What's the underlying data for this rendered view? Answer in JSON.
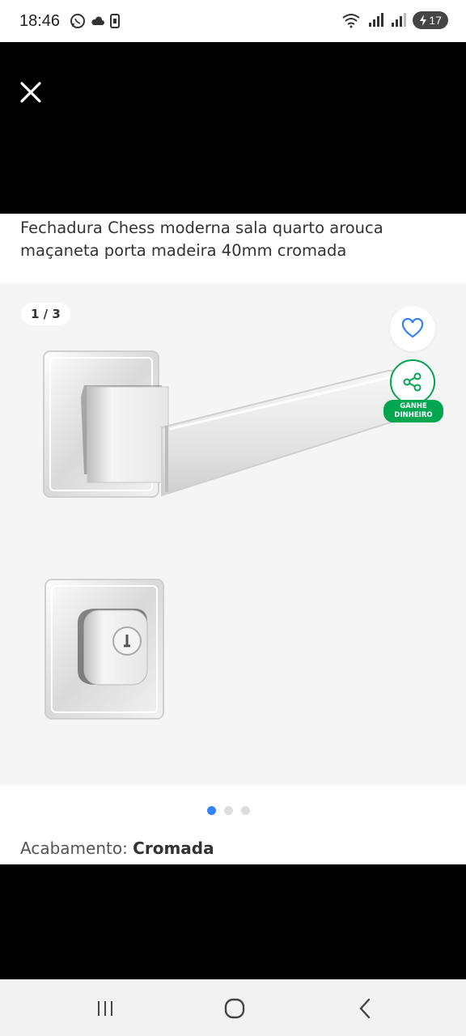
{
  "status_bar": {
    "time": "18:46",
    "battery": "17"
  },
  "product": {
    "title": "Fechadura Chess moderna sala quarto arouca maçaneta porta madeira 40mm cromada",
    "gallery": {
      "counter": "1 / 3",
      "earn_badge_line1": "GANHE",
      "earn_badge_line2": "DINHEIRO",
      "total_images": 3,
      "active_index": 0
    },
    "finish_label": "Acabamento:",
    "finish_value": "Cromada"
  },
  "colors": {
    "accent_green": "#00a650",
    "active_dot": "#3483fa",
    "favorite_icon": "#3483fa"
  },
  "icons": {
    "close": "close-icon",
    "favorite": "heart-icon",
    "share": "share-icon",
    "nav_recents": "recents-icon",
    "nav_home": "home-icon",
    "nav_back": "back-icon"
  }
}
